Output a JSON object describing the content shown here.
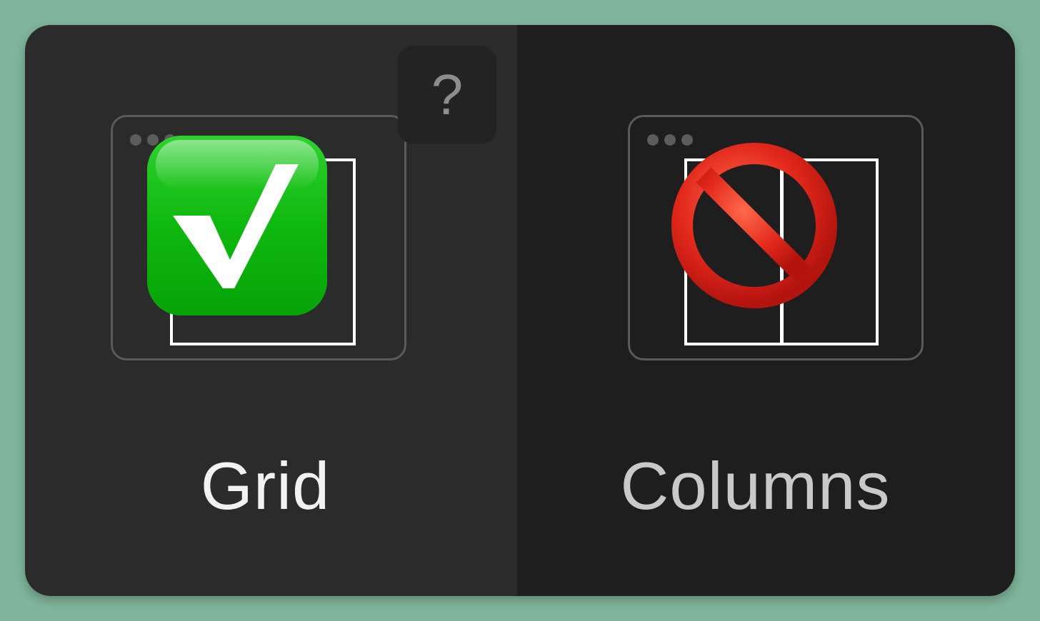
{
  "options": {
    "grid": {
      "label": "Grid",
      "selected": true,
      "status_icon": "check-mark-button-icon"
    },
    "columns": {
      "label": "Columns",
      "selected": false,
      "status_icon": "prohibited-icon"
    }
  },
  "help": {
    "label": "?"
  },
  "colors": {
    "background": "#7fb59b",
    "selected_panel": "#2b2b2b",
    "unselected_panel": "#1e1e1e",
    "check_green": "#13b513",
    "prohibited_red": "#e0241b"
  }
}
